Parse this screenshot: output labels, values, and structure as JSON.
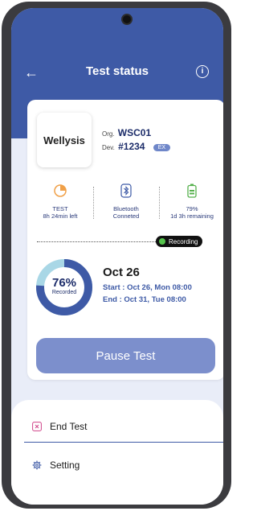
{
  "header": {
    "title": "Test status",
    "back_icon": "arrow-left-icon",
    "info_icon": "info-icon"
  },
  "device": {
    "logo_text": "Wellysis",
    "org_label": "Org.",
    "org_value": "WSC01",
    "dev_label": "Dev.",
    "dev_value": "#1234",
    "badge": "EX"
  },
  "stats": [
    {
      "icon": "pie-chart-icon",
      "line1": "TEST",
      "line2": "8h 24min left",
      "color": "#f0a048"
    },
    {
      "icon": "bluetooth-icon",
      "line1": "Bluetooth",
      "line2": "Conneted",
      "color": "#3e5aa6"
    },
    {
      "icon": "battery-icon",
      "line1": "79%",
      "line2": "1d 3h remaining",
      "color": "#55b04c"
    }
  ],
  "recording": {
    "label": "Recording",
    "dot_color": "#55c44c"
  },
  "progress": {
    "percent_text": "76%",
    "label": "Recorded",
    "fraction": 0.76
  },
  "schedule": {
    "date": "Oct 26",
    "start": "Start : Oct 26, Mon 08:00",
    "end": "End : Oct 31, Tue 08:00"
  },
  "actions": {
    "pause_label": "Pause Test"
  },
  "menu": [
    {
      "icon": "close-square-icon",
      "label": "End Test"
    },
    {
      "icon": "gear-icon",
      "label": "Setting"
    }
  ],
  "colors": {
    "primary": "#3e5aa6",
    "button": "#7c8fcc",
    "ring_track": "#a9d7e6",
    "ring_fill": "#3e5aa6"
  }
}
